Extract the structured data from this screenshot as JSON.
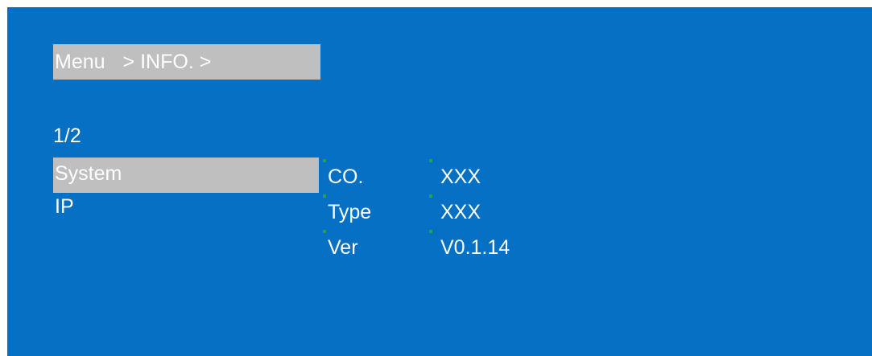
{
  "breadcrumb": {
    "root": "Menu",
    "separator": ">",
    "section": "INFO.",
    "trailing": ">"
  },
  "page_indicator": "1/2",
  "menu": {
    "items": [
      {
        "label": "System",
        "selected": true
      },
      {
        "label": "IP",
        "selected": false
      }
    ]
  },
  "info": {
    "rows": [
      {
        "key": "CO.",
        "value": "XXX"
      },
      {
        "key": "Type",
        "value": "XXX"
      },
      {
        "key": "Ver",
        "value": "V0.1.14"
      }
    ]
  },
  "colors": {
    "background": "#0570c4",
    "highlight": "#bfbfbf",
    "text": "#ffffff",
    "marker": "#2aa04a"
  }
}
